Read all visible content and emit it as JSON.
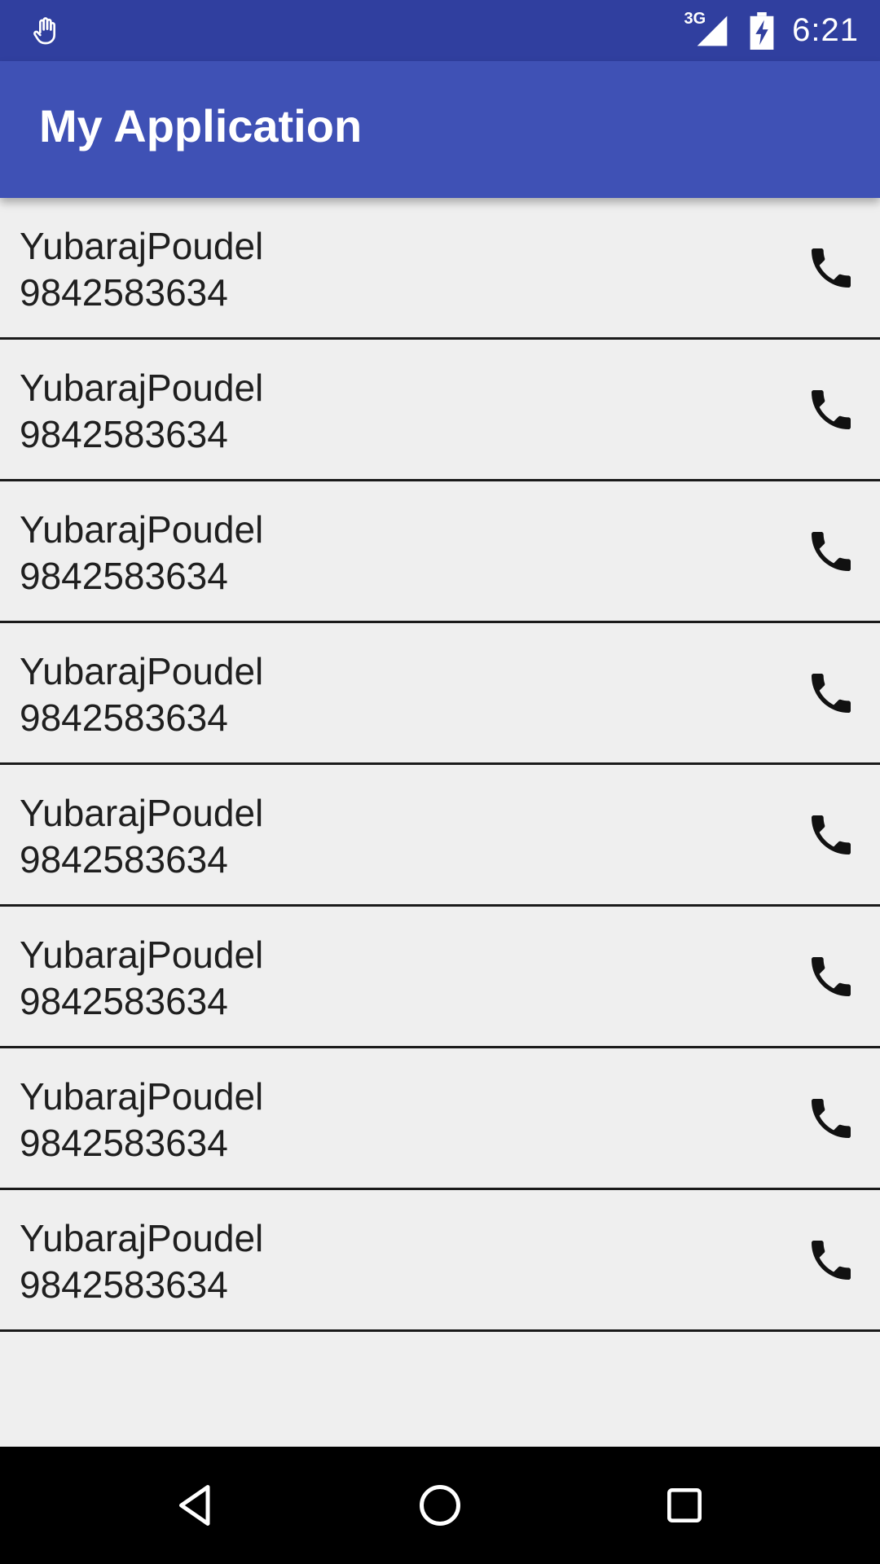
{
  "status_bar": {
    "time": "6:21",
    "network": "3G",
    "left_icon": "hand-icon",
    "signal_icon": "signal-icon",
    "battery_icon": "battery-charging-icon"
  },
  "app_bar": {
    "title": "My Application",
    "color": "#3f51b5",
    "status_color": "#303f9f"
  },
  "contacts": [
    {
      "name": "YubarajPoudel",
      "phone": "9842583634"
    },
    {
      "name": "YubarajPoudel",
      "phone": "9842583634"
    },
    {
      "name": "YubarajPoudel",
      "phone": "9842583634"
    },
    {
      "name": "YubarajPoudel",
      "phone": "9842583634"
    },
    {
      "name": "YubarajPoudel",
      "phone": "9842583634"
    },
    {
      "name": "YubarajPoudel",
      "phone": "9842583634"
    },
    {
      "name": "YubarajPoudel",
      "phone": "9842583634"
    },
    {
      "name": "YubarajPoudel",
      "phone": "9842583634"
    }
  ],
  "row_icon": "phone-icon",
  "nav_bar": {
    "back_icon": "back-triangle-icon",
    "home_icon": "home-circle-icon",
    "recents_icon": "recents-square-icon"
  }
}
